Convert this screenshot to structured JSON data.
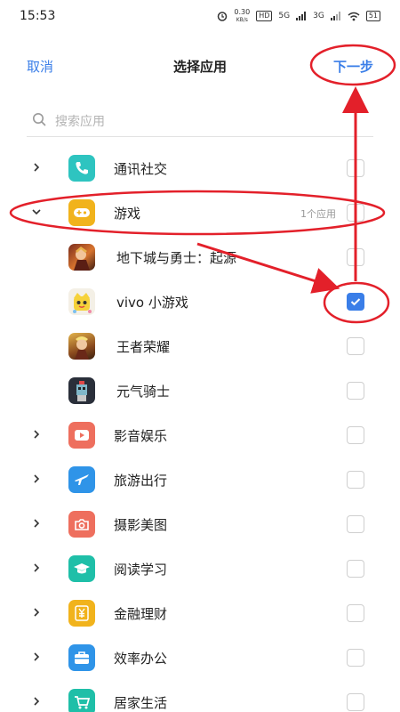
{
  "status_bar": {
    "time": "15:53",
    "net_speed_value": "0.30",
    "net_speed_unit": "KB/s",
    "hd_badge": "HD",
    "signal1": "5G",
    "signal2": "3G",
    "battery": "51"
  },
  "nav": {
    "cancel_label": "取消",
    "title": "选择应用",
    "next_label": "下一步"
  },
  "search": {
    "placeholder": "搜索应用"
  },
  "colors": {
    "accent": "#3a7ee8",
    "annotation": "#e3202a",
    "icon_social": "#2ec4c0",
    "icon_game": "#f1b31c",
    "icon_media": "#ee6f5e",
    "icon_travel": "#2f94e8",
    "icon_photo": "#ee6f5e",
    "icon_reading": "#1fbfa8",
    "icon_finance": "#f1b31c",
    "icon_office": "#2f94e8",
    "icon_home": "#1fbfa8"
  },
  "list": [
    {
      "type": "category",
      "label": "通讯社交",
      "icon": "phone-icon",
      "expanded": false,
      "checked": false
    },
    {
      "type": "category",
      "label": "游戏",
      "icon": "gamepad-icon",
      "expanded": true,
      "count": "1个应用",
      "checked": false
    },
    {
      "type": "app",
      "label": "地下城与勇士：起源",
      "icon": "dnf-app-icon",
      "checked": false
    },
    {
      "type": "app",
      "label": "vivo 小游戏",
      "icon": "vivo-minigame-app-icon",
      "checked": true
    },
    {
      "type": "app",
      "label": "王者荣耀",
      "icon": "honor-of-kings-app-icon",
      "checked": false
    },
    {
      "type": "app",
      "label": "元气骑士",
      "icon": "soul-knight-app-icon",
      "checked": false
    },
    {
      "type": "category",
      "label": "影音娱乐",
      "icon": "play-icon",
      "expanded": false,
      "checked": false
    },
    {
      "type": "category",
      "label": "旅游出行",
      "icon": "airplane-icon",
      "expanded": false,
      "checked": false
    },
    {
      "type": "category",
      "label": "摄影美图",
      "icon": "camera-icon",
      "expanded": false,
      "checked": false
    },
    {
      "type": "category",
      "label": "阅读学习",
      "icon": "graduation-cap-icon",
      "expanded": false,
      "checked": false
    },
    {
      "type": "category",
      "label": "金融理财",
      "icon": "yen-icon",
      "expanded": false,
      "checked": false
    },
    {
      "type": "category",
      "label": "效率办公",
      "icon": "briefcase-icon",
      "expanded": false,
      "checked": false
    },
    {
      "type": "category",
      "label": "居家生活",
      "icon": "cart-icon",
      "expanded": false,
      "checked": false
    }
  ]
}
